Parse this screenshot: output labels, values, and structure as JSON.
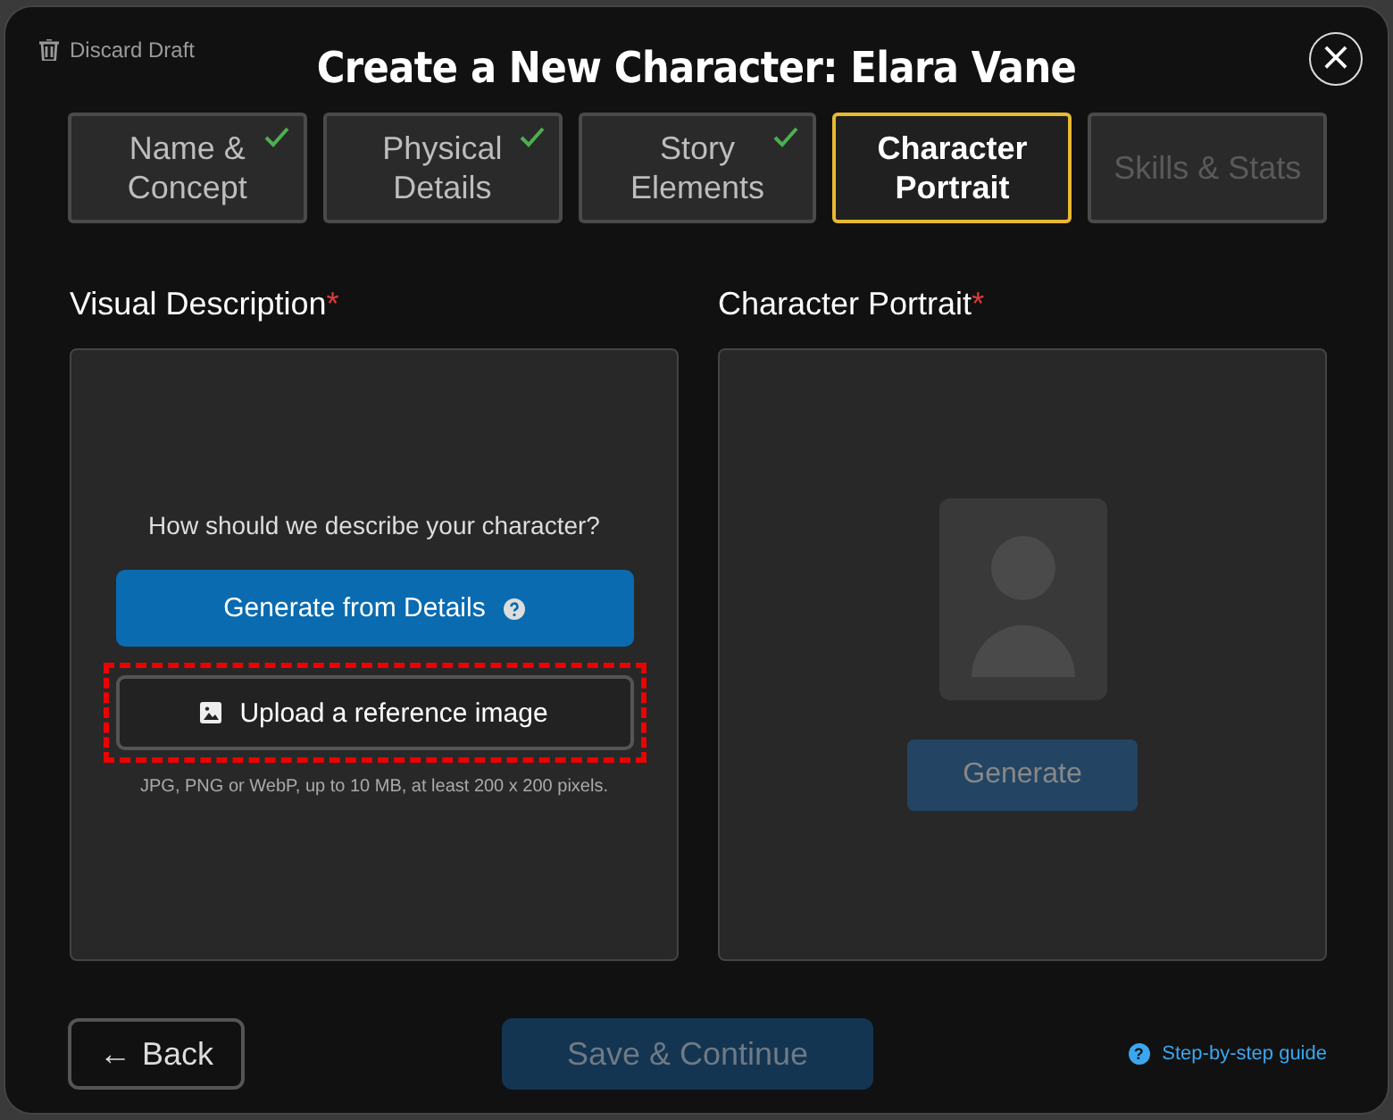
{
  "header": {
    "discard": "Discard Draft",
    "title": "Create a New Character: Elara Vane",
    "close": "×"
  },
  "steps": [
    {
      "label": "Name & Concept",
      "completed": true,
      "selected": false,
      "disabled": false
    },
    {
      "label": "Physical Details",
      "completed": true,
      "selected": false,
      "disabled": false
    },
    {
      "label": "Story Elements",
      "completed": true,
      "selected": false,
      "disabled": false
    },
    {
      "label": "Character Portrait",
      "completed": false,
      "selected": true,
      "disabled": false
    },
    {
      "label": "Skills & Stats",
      "completed": false,
      "selected": false,
      "disabled": true
    }
  ],
  "visual_description": {
    "heading": "Visual Description",
    "required": "*",
    "prompt": "How should we describe your character?",
    "generate_button": {
      "label": "Generate from Details",
      "disabled": false
    },
    "upload_button": {
      "label": "Upload a reference image",
      "highlighted": true
    },
    "hint": "JPG, PNG or WebP, up to 10 MB, at least 200 x 200 pixels."
  },
  "character_portrait": {
    "heading": "Character Portrait",
    "required": "*",
    "generate_button": {
      "label": "Generate",
      "disabled": true
    }
  },
  "footer": {
    "back": {
      "arrow": "←",
      "label": "Back"
    },
    "save_button": {
      "label": "Save & Continue",
      "disabled": true
    },
    "guide_link": {
      "icon": "?",
      "label": "Step-by-step guide"
    }
  }
}
